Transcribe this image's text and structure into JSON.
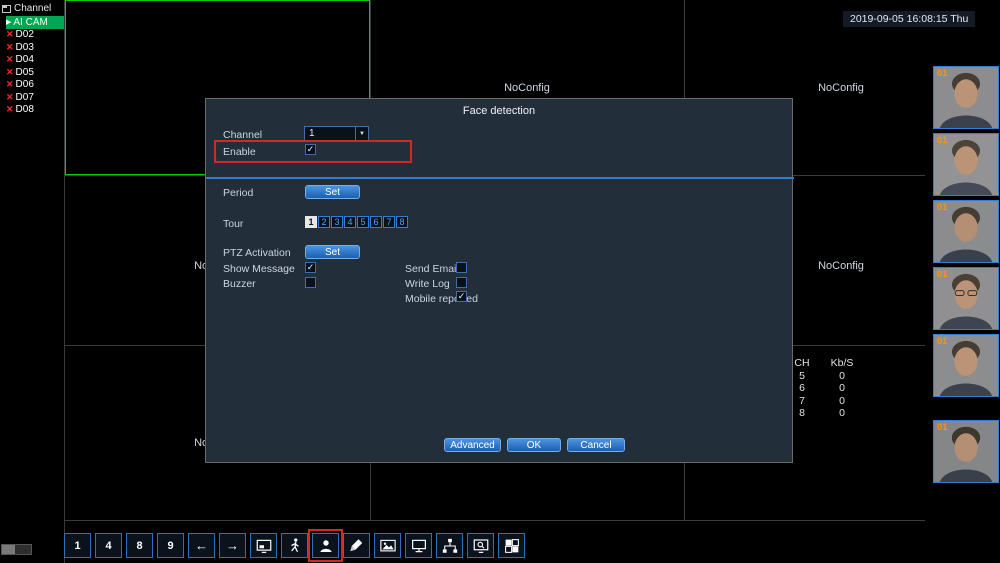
{
  "icons": {
    "offline": "✕",
    "selected_arrow": "▶",
    "dropdown_arrow": "▼",
    "check": "✓"
  },
  "colors": {
    "accent_blue": "#2d7fd9",
    "alert_red": "#d42a1e",
    "selected_green": "#00a651",
    "thumb_label_orange": "#ff9500"
  },
  "header": {
    "timestamp": "2019-09-05 16:08:15 Thu"
  },
  "sidebar": {
    "title": "Channel",
    "items": [
      {
        "label": "AI CAM",
        "state": "selected"
      },
      {
        "label": "D02",
        "state": "offline"
      },
      {
        "label": "D03",
        "state": "offline"
      },
      {
        "label": "D04",
        "state": "offline"
      },
      {
        "label": "D05",
        "state": "offline"
      },
      {
        "label": "D06",
        "state": "offline"
      },
      {
        "label": "D07",
        "state": "offline"
      },
      {
        "label": "D08",
        "state": "offline"
      }
    ]
  },
  "video_grid": {
    "noconfig": "NoConfig"
  },
  "stats": {
    "col1_header": "CH",
    "col2_header": "Kb/S",
    "rows": [
      {
        "ch": "5",
        "kbs": "0"
      },
      {
        "ch": "6",
        "kbs": "0"
      },
      {
        "ch": "7",
        "kbs": "0"
      },
      {
        "ch": "8",
        "kbs": "0"
      }
    ]
  },
  "thumbnails": {
    "channel_label": "01",
    "count": 6
  },
  "dialog": {
    "title": "Face detection",
    "channel": {
      "label": "Channel",
      "value": "1"
    },
    "enable": {
      "label": "Enable",
      "checked": true
    },
    "period": {
      "label": "Period",
      "button": "Set"
    },
    "tour": {
      "label": "Tour",
      "options": [
        "1",
        "2",
        "3",
        "4",
        "5",
        "6",
        "7",
        "8"
      ],
      "selected": "1"
    },
    "ptz": {
      "label": "PTZ Activation",
      "button": "Set"
    },
    "show_message": {
      "label": "Show Message",
      "checked": true
    },
    "send_email": {
      "label": "Send Email",
      "checked": false
    },
    "buzzer": {
      "label": "Buzzer",
      "checked": false
    },
    "write_log": {
      "label": "Write Log",
      "checked": false
    },
    "mobile_reported": {
      "label": "Mobile reported",
      "checked": true
    },
    "buttons": {
      "advanced": "Advanced",
      "ok": "OK",
      "cancel": "Cancel"
    }
  },
  "toolbar": {
    "items": [
      {
        "name": "screen-split-1",
        "glyph": "1"
      },
      {
        "name": "screen-split-4",
        "glyph": "4"
      },
      {
        "name": "screen-split-8",
        "glyph": "8"
      },
      {
        "name": "screen-split-9",
        "glyph": "9"
      },
      {
        "name": "previous-page",
        "glyph": "←"
      },
      {
        "name": "next-page",
        "glyph": "→"
      },
      {
        "name": "pip-display"
      },
      {
        "name": "motion-detection"
      },
      {
        "name": "face-detection",
        "active": true
      },
      {
        "name": "color-brush"
      },
      {
        "name": "snapshot"
      },
      {
        "name": "display-settings"
      },
      {
        "name": "network-topology"
      },
      {
        "name": "screen-zoom"
      },
      {
        "name": "pixel-mosaic"
      }
    ]
  }
}
